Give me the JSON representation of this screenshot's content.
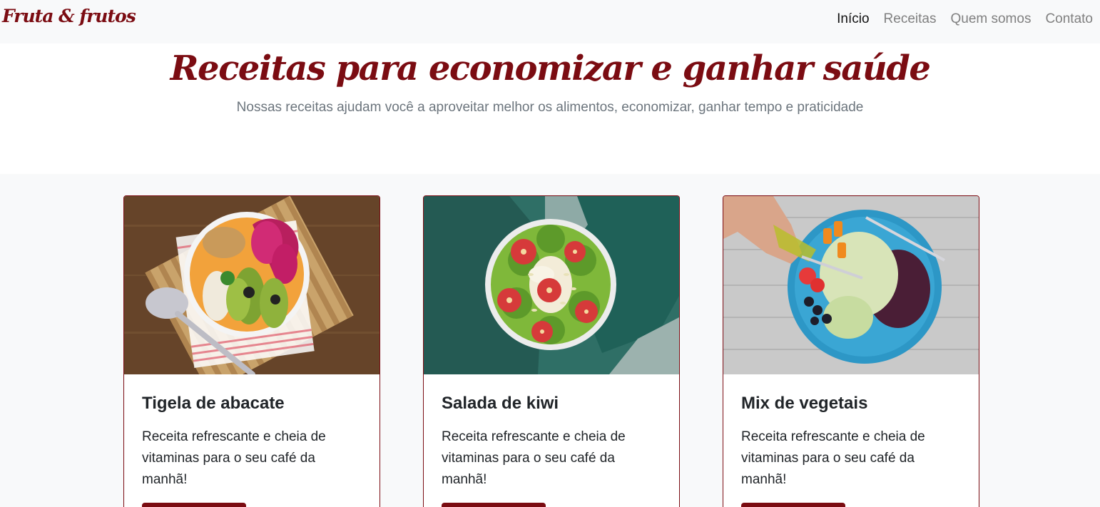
{
  "navbar": {
    "brand": "Fruta & frutos",
    "links": [
      {
        "label": "Início",
        "active": true
      },
      {
        "label": "Receitas",
        "active": false
      },
      {
        "label": "Quem somos",
        "active": false
      },
      {
        "label": "Contato",
        "active": false
      }
    ]
  },
  "hero": {
    "title": "Receitas para economizar e ganhar saúde",
    "subtitle": "Nossas receitas ajudam você a aproveitar melhor os alimentos, economizar, ganhar tempo e praticidade"
  },
  "cards": [
    {
      "title": "Tigela de abacate",
      "text": "Receita refrescante e cheia de vitaminas para o seu café da manhã!",
      "image": "avocado-bowl-photo"
    },
    {
      "title": "Salada de kiwi",
      "text": "Receita refrescante e cheia de vitaminas para o seu café da manhã!",
      "image": "kiwi-bowl-photo"
    },
    {
      "title": "Mix de vegetais",
      "text": "Receita refrescante e cheia de vitaminas para o seu café da manhã!",
      "image": "vegetable-plate-photo"
    }
  ],
  "colors": {
    "brand": "#7b0c12",
    "navbar_bg": "#f8f9fa",
    "muted_text": "#6c757d"
  }
}
